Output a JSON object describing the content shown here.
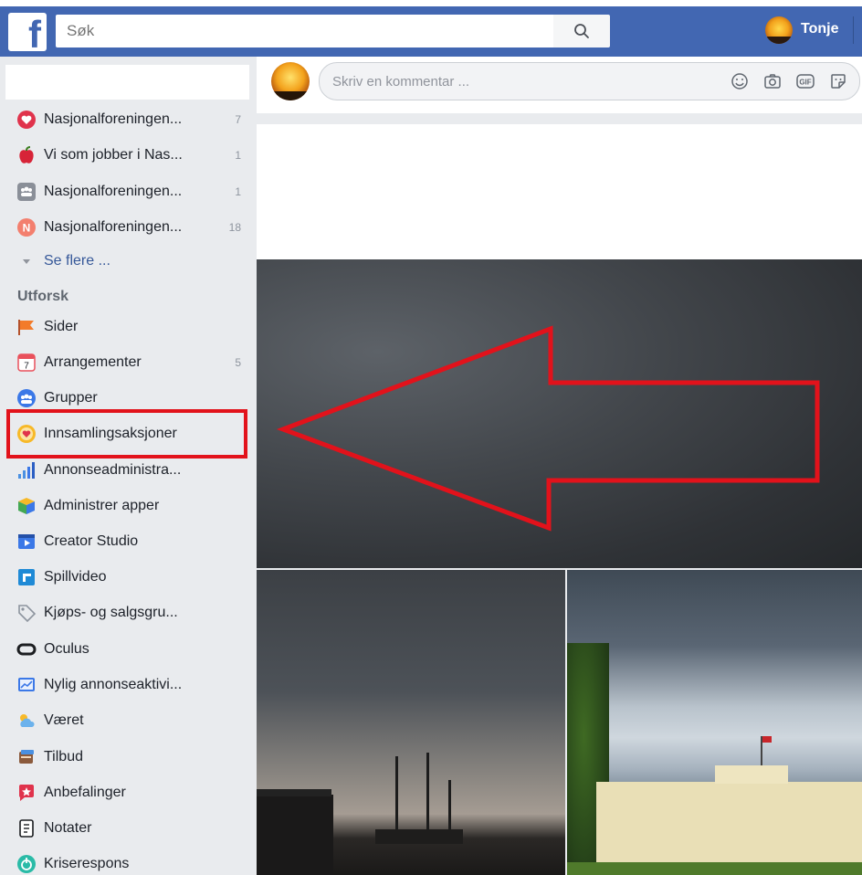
{
  "topbar": {
    "logo": "f",
    "search_placeholder": "Søk",
    "user_name": "Tonje"
  },
  "sidebar": {
    "shortcuts": [
      {
        "label": "Nasjonalforeningen...",
        "count": "7"
      },
      {
        "label": "Vi som jobber i Nas...",
        "count": "1"
      },
      {
        "label": "Nasjonalforeningen...",
        "count": "1"
      },
      {
        "label": "Nasjonalforeningen...",
        "count": "18"
      }
    ],
    "see_more": "Se flere ...",
    "explore_heading": "Utforsk",
    "explore": [
      {
        "label": "Sider",
        "count": ""
      },
      {
        "label": "Arrangementer",
        "count": "5"
      },
      {
        "label": "Grupper",
        "count": ""
      },
      {
        "label": "Innsamlingsaksjoner",
        "count": ""
      },
      {
        "label": "Annonseadministra...",
        "count": ""
      },
      {
        "label": "Administrer apper",
        "count": ""
      },
      {
        "label": "Creator Studio",
        "count": ""
      },
      {
        "label": "Spillvideo",
        "count": ""
      },
      {
        "label": "Kjøps- og salgsgru...",
        "count": ""
      },
      {
        "label": "Oculus",
        "count": ""
      },
      {
        "label": "Nylig annonseaktivi...",
        "count": ""
      },
      {
        "label": "Været",
        "count": ""
      },
      {
        "label": "Tilbud",
        "count": ""
      },
      {
        "label": "Anbefalinger",
        "count": ""
      },
      {
        "label": "Notater",
        "count": ""
      },
      {
        "label": "Kriserespons",
        "count": ""
      }
    ],
    "calendar_day": "7",
    "n_badge": "N"
  },
  "comment": {
    "placeholder": "Skriv en kommentar ...",
    "gif_label": "GIF"
  },
  "colors": {
    "brand_blue": "#4267b2",
    "highlight_red": "#e2121b",
    "link_blue": "#365899"
  }
}
